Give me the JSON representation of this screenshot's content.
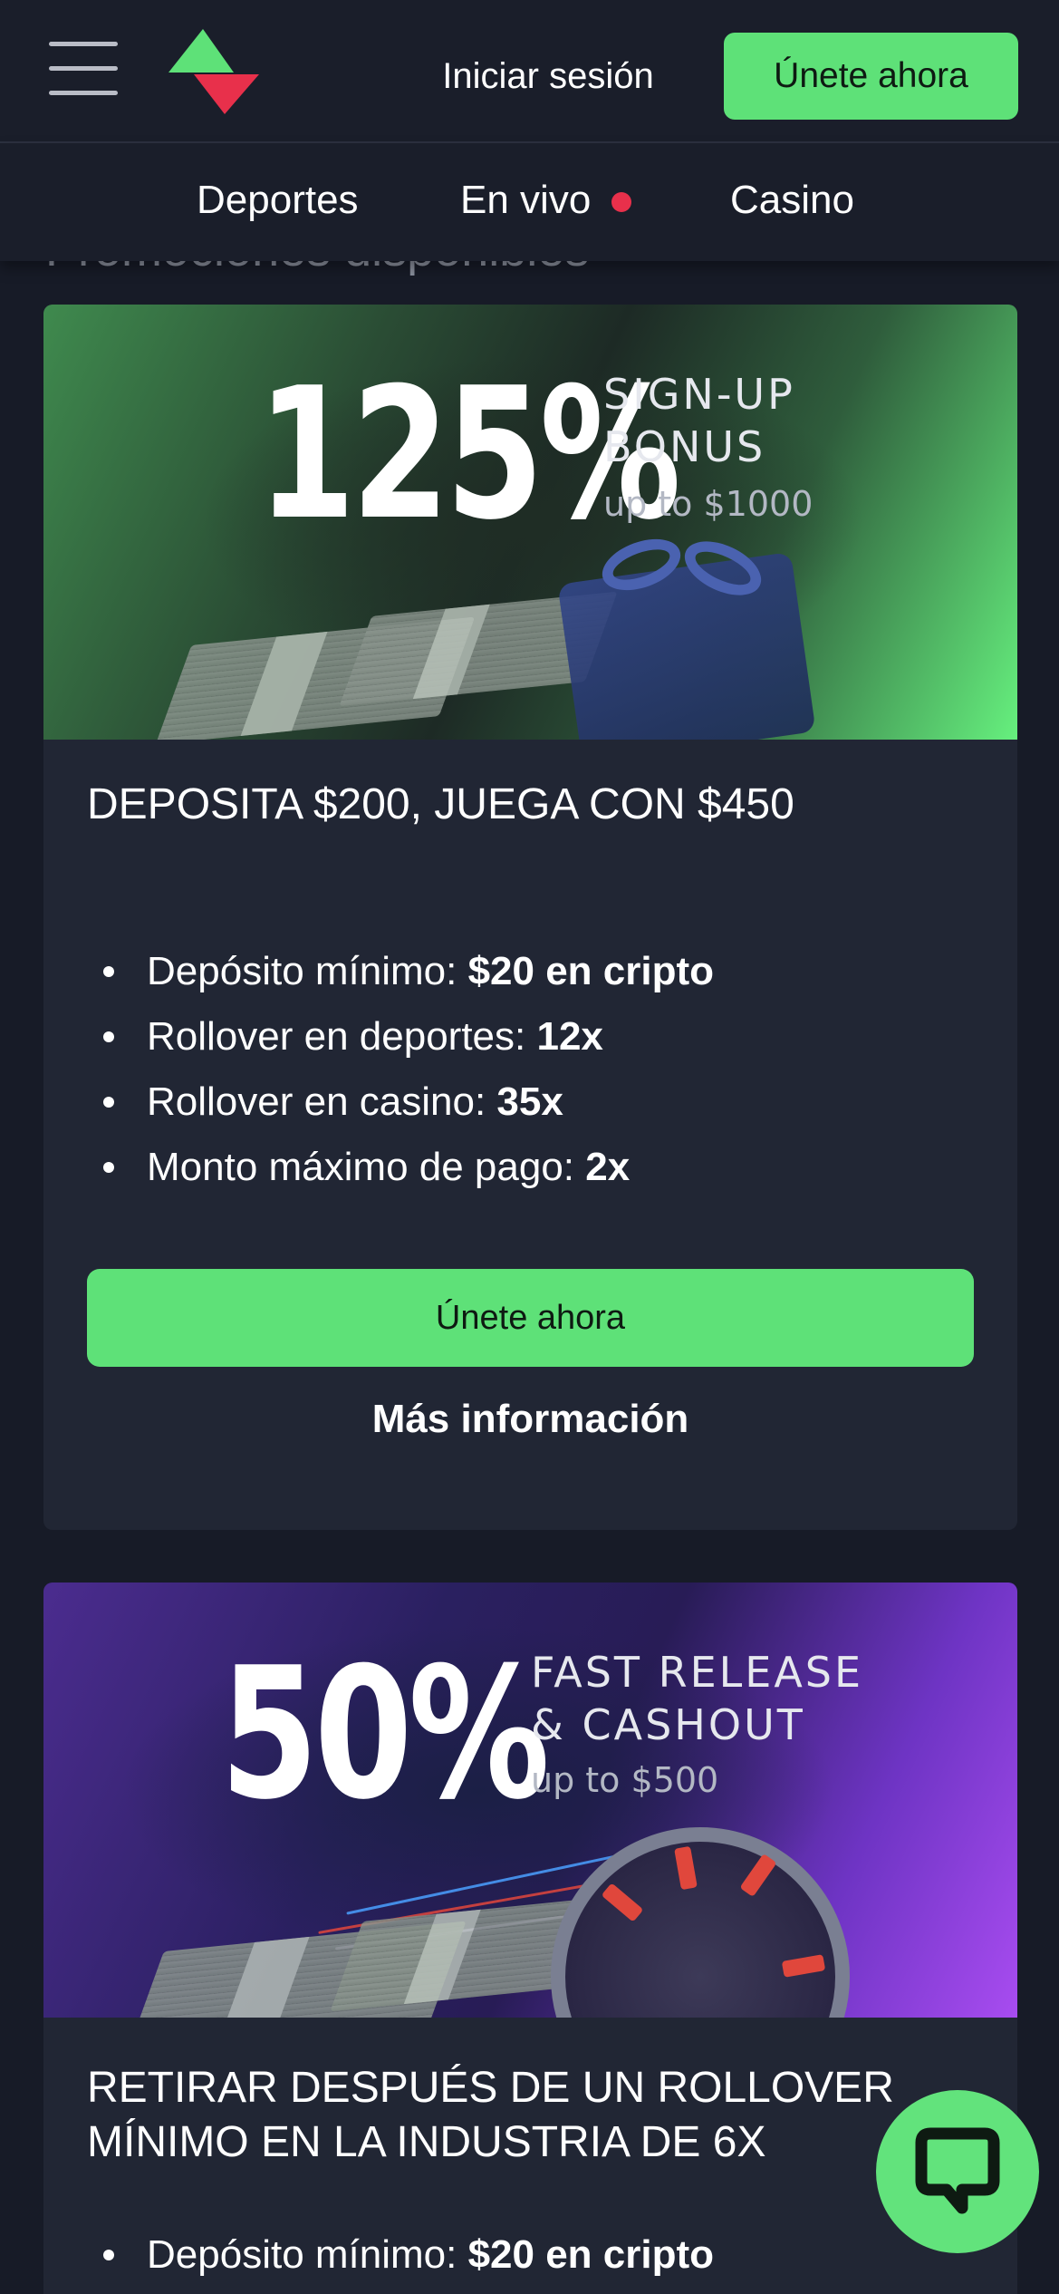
{
  "header": {
    "signin_label": "Iniciar sesión",
    "join_label": "Únete ahora"
  },
  "nav": {
    "items": [
      {
        "label": "Deportes"
      },
      {
        "label": "En vivo"
      },
      {
        "label": "Casino"
      }
    ]
  },
  "section_heading": "Promociones disponibles",
  "promos": [
    {
      "banner": {
        "percent": "125%",
        "line1": "SIGN-UP",
        "line2": "BONUS",
        "line3": "up to $1000"
      },
      "title": "DEPOSITA $200, JUEGA CON $450",
      "bullets": [
        {
          "label": "Depósito mínimo: ",
          "value": "$20 en cripto"
        },
        {
          "label": "Rollover en deportes: ",
          "value": "12x"
        },
        {
          "label": "Rollover en casino: ",
          "value": "35x"
        },
        {
          "label": "Monto máximo de pago: ",
          "value": "2x"
        }
      ],
      "join_label": "Únete ahora",
      "more_label": "Más información"
    },
    {
      "banner": {
        "percent": "50%",
        "line1": "FAST RELEASE",
        "line2": "& CASHOUT",
        "line3": "up to $500"
      },
      "title": "RETIRAR DESPUÉS DE UN ROLLOVER MÍNIMO EN LA INDUSTRIA DE 6X",
      "bullets": [
        {
          "label": "Depósito mínimo: ",
          "value": "$20 en cripto"
        }
      ]
    }
  ],
  "colors": {
    "accent_green": "#5ee178",
    "live_dot": "#e8304b",
    "page_bg": "#171b27",
    "card_bg": "#212634"
  },
  "icons": {
    "menu": "hamburger-menu-icon",
    "logo": "brand-logo",
    "chat": "chat-bubble-icon"
  }
}
